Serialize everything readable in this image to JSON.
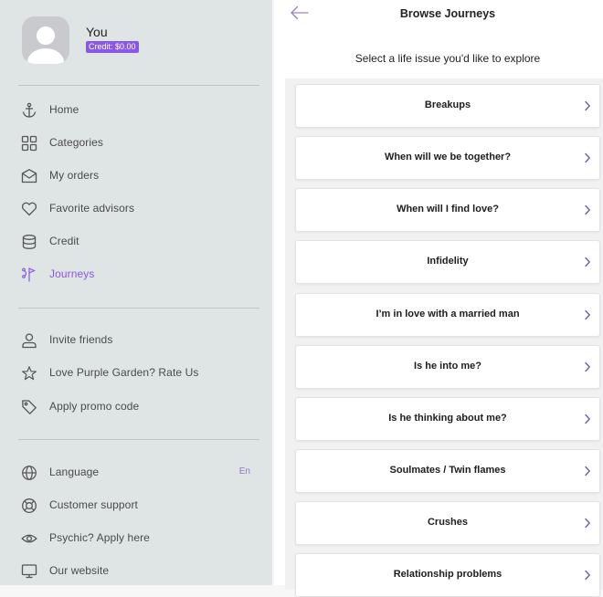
{
  "profile": {
    "name": "You",
    "credit": "Credit: $0.00"
  },
  "sidebar": {
    "group1": [
      {
        "label": "Home",
        "icon": "anchor-icon"
      },
      {
        "label": "Categories",
        "icon": "grid-icon"
      },
      {
        "label": "My orders",
        "icon": "envelope-icon"
      },
      {
        "label": "Favorite advisors",
        "icon": "heart-icon"
      },
      {
        "label": "Credit",
        "icon": "coins-icon"
      },
      {
        "label": "Journeys",
        "icon": "journey-icon",
        "active": true
      }
    ],
    "group2": [
      {
        "label": "Invite friends",
        "icon": "person-icon"
      },
      {
        "label": "Love Purple Garden? Rate Us",
        "icon": "star-icon"
      },
      {
        "label": "Apply promo code",
        "icon": "tag-icon"
      }
    ],
    "group3": [
      {
        "label": "Language",
        "icon": "globe-icon",
        "value": "En"
      },
      {
        "label": "Customer support",
        "icon": "lifebuoy-icon"
      },
      {
        "label": "Psychic? Apply here",
        "icon": "eye-icon"
      },
      {
        "label": "Our website",
        "icon": "monitor-icon"
      }
    ]
  },
  "header": {
    "title": "Browse Journeys",
    "subtitle": "Select a life issue you'd like to explore"
  },
  "journeys": [
    "Breakups",
    "When will we be together?",
    "When will I find love?",
    "Infidelity",
    "I’m in love with a married man",
    "Is he into me?",
    "Is he thinking about me?",
    "Soulmates / Twin flames",
    "Crushes",
    "Relationship problems"
  ],
  "colors": {
    "accent": "#8a57e6",
    "sidebar_bg": "#dfe4e4",
    "chevron": "#6b5bb8"
  }
}
